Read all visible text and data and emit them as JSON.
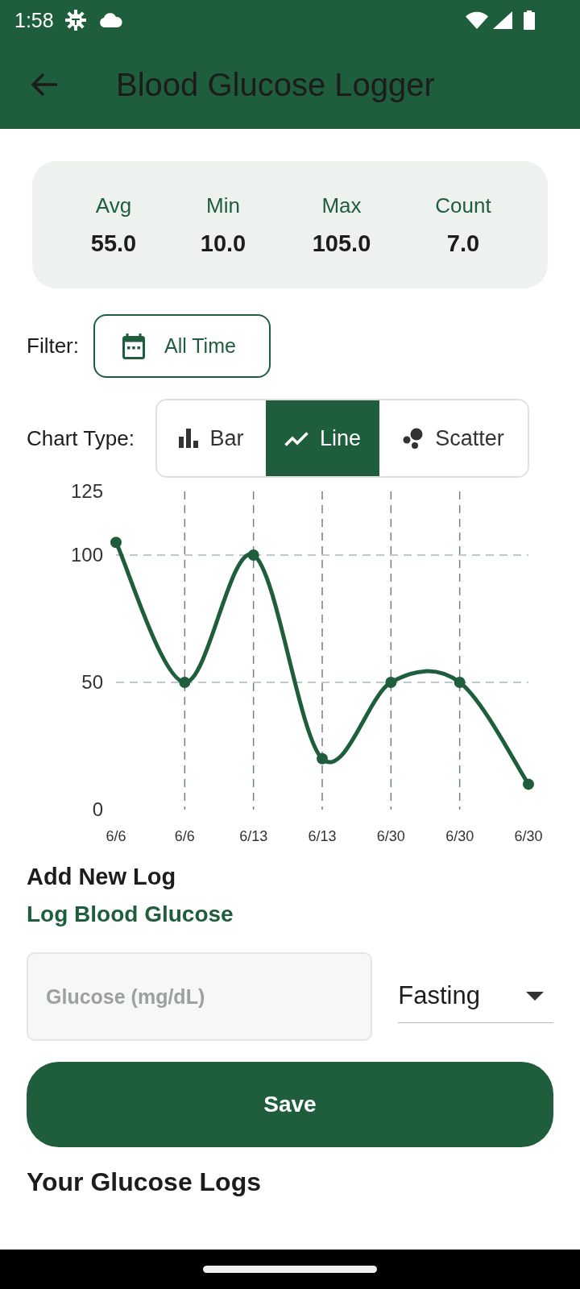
{
  "status_bar": {
    "time": "1:58"
  },
  "app_bar": {
    "title": "Blood Glucose Logger"
  },
  "stats": [
    {
      "label": "Avg",
      "value": "55.0"
    },
    {
      "label": "Min",
      "value": "10.0"
    },
    {
      "label": "Max",
      "value": "105.0"
    },
    {
      "label": "Count",
      "value": "7.0"
    }
  ],
  "filter": {
    "label": "Filter:",
    "button": "All Time"
  },
  "chart_type": {
    "label": "Chart Type:",
    "options": [
      {
        "label": "Bar",
        "kind": "bar",
        "selected": false
      },
      {
        "label": "Line",
        "kind": "line",
        "selected": true
      },
      {
        "label": "Scatter",
        "kind": "scatter",
        "selected": false
      }
    ]
  },
  "chart": {
    "chart_data": {
      "type": "line",
      "categories": [
        "6/6",
        "6/6",
        "6/13",
        "6/13",
        "6/30",
        "6/30",
        "6/30"
      ],
      "series": [
        {
          "color": "#1f5e3c",
          "marker": "circle",
          "values": [
            105,
            50,
            100,
            20,
            50,
            50,
            10
          ]
        }
      ],
      "ylim": [
        0,
        125
      ],
      "yticks": [
        0,
        50,
        100,
        125
      ],
      "grid": true
    }
  },
  "add_log": {
    "heading": "Add New Log",
    "subheading": "Log Blood Glucose",
    "glucose_field": {
      "placeholder": "Glucose (mg/dL)"
    },
    "meal_dropdown": {
      "value": "Fasting"
    },
    "save_button": "Save"
  },
  "logs": {
    "heading": "Your Glucose Logs"
  }
}
